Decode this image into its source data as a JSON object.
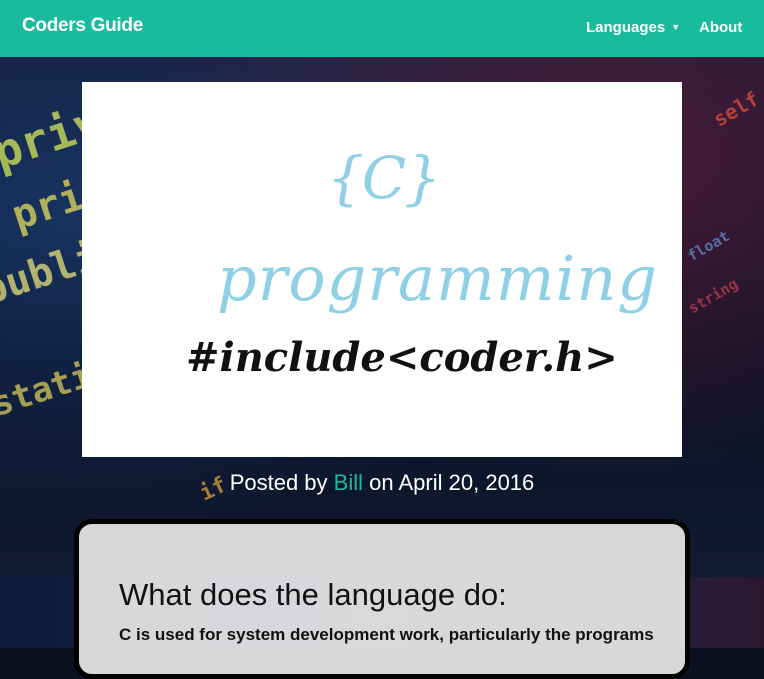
{
  "navbar": {
    "brand": "Coders Guide",
    "languages_label": "Languages",
    "about_label": "About",
    "color": "#18bc9c"
  },
  "header_image": {
    "braces_text": "{C}",
    "word_text": "programming",
    "include_text": "#include<coder.h>",
    "logo_color": "#8fd0e6"
  },
  "post": {
    "posted_by_prefix": "Posted by",
    "author": "Bill",
    "date_text": "on April 20, 2016"
  },
  "card": {
    "title": "What does the language do:",
    "text": "C is used for system development work, particularly the programs"
  },
  "background_code_lines": [
    "private",
    "printf",
    "public",
    "static",
    "self",
    "float",
    "string",
    "if"
  ]
}
